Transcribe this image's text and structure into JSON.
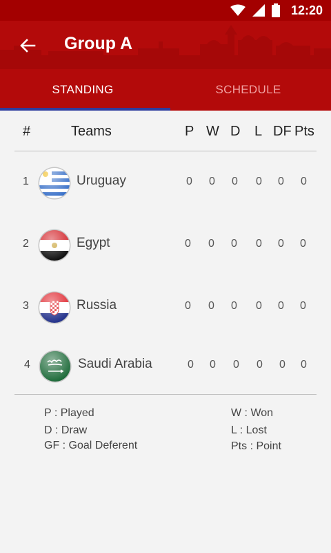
{
  "status_bar": {
    "time": "12:20"
  },
  "header": {
    "title": "Group A"
  },
  "tabs": [
    {
      "label": "STANDING",
      "active": true
    },
    {
      "label": "SCHEDULE",
      "active": false
    }
  ],
  "table": {
    "columns": [
      "#",
      "Teams",
      "P",
      "W",
      "D",
      "L",
      "DF",
      "Pts"
    ],
    "rows": [
      {
        "rank": "1",
        "team": "Uruguay",
        "flag": "uruguay-flag-icon",
        "P": "0",
        "W": "0",
        "D": "0",
        "L": "0",
        "DF": "0",
        "Pts": "0"
      },
      {
        "rank": "2",
        "team": "Egypt",
        "flag": "egypt-flag-icon",
        "P": "0",
        "W": "0",
        "D": "0",
        "L": "0",
        "DF": "0",
        "Pts": "0"
      },
      {
        "rank": "3",
        "team": "Russia",
        "flag": "croatia-flag-icon",
        "P": "0",
        "W": "0",
        "D": "0",
        "L": "0",
        "DF": "0",
        "Pts": "0"
      },
      {
        "rank": "4",
        "team": "Saudi Arabia",
        "flag": "saudi-arabia-flag-icon",
        "P": "0",
        "W": "0",
        "D": "0",
        "L": "0",
        "DF": "0",
        "Pts": "0"
      }
    ]
  },
  "legend": {
    "played": "P : Played",
    "won": "W : Won",
    "draw": "D : Draw",
    "lost": "L : Lost",
    "goal_diff": "GF : Goal Deferent",
    "point": "Pts : Point"
  },
  "colors": {
    "primary": "#b30a0a",
    "status": "#a30000",
    "indicator": "#2e3c9e",
    "background": "#f3f3f3"
  }
}
